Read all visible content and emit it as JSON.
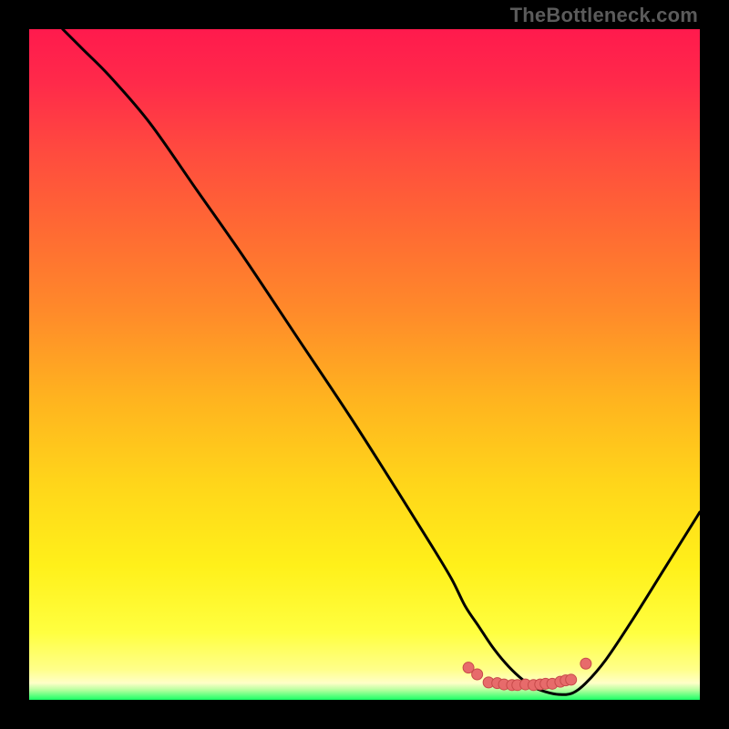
{
  "watermark": "TheBottleneck.com",
  "colors": {
    "background": "#000000",
    "gradient_stops": [
      {
        "offset": 0.0,
        "color": "#ff1a4d"
      },
      {
        "offset": 0.08,
        "color": "#ff2a4a"
      },
      {
        "offset": 0.18,
        "color": "#ff4a3f"
      },
      {
        "offset": 0.3,
        "color": "#ff6a33"
      },
      {
        "offset": 0.42,
        "color": "#ff8a2a"
      },
      {
        "offset": 0.55,
        "color": "#ffb31f"
      },
      {
        "offset": 0.68,
        "color": "#ffd61a"
      },
      {
        "offset": 0.8,
        "color": "#fff01a"
      },
      {
        "offset": 0.9,
        "color": "#ffff40"
      },
      {
        "offset": 0.955,
        "color": "#ffff8a"
      },
      {
        "offset": 0.975,
        "color": "#ffffc8"
      },
      {
        "offset": 0.985,
        "color": "#b8ffa0"
      },
      {
        "offset": 1.0,
        "color": "#1aff66"
      }
    ],
    "curve": "#000000",
    "marker_fill": "#e76b6b",
    "marker_stroke": "#c74a4a"
  },
  "chart_data": {
    "type": "line",
    "title": "",
    "xlabel": "",
    "ylabel": "",
    "xlim": [
      0,
      100
    ],
    "ylim": [
      0,
      100
    ],
    "series": [
      {
        "name": "bottleneck-curve",
        "x": [
          5,
          8,
          12,
          18,
          25,
          32,
          40,
          48,
          55,
          60,
          63,
          65,
          67,
          69,
          71,
          73,
          75,
          77,
          79,
          81,
          83,
          86,
          90,
          95,
          100
        ],
        "y": [
          100,
          97,
          93,
          86,
          76,
          66,
          54,
          42,
          31,
          23,
          18,
          14,
          11,
          8,
          5.5,
          3.5,
          2,
          1.2,
          0.8,
          1.0,
          2.5,
          6,
          12,
          20,
          28
        ]
      }
    ],
    "markers": {
      "name": "bottom-cluster",
      "points": [
        {
          "x": 65.5,
          "y": 4.8
        },
        {
          "x": 66.8,
          "y": 3.8
        },
        {
          "x": 68.5,
          "y": 2.6
        },
        {
          "x": 69.8,
          "y": 2.5
        },
        {
          "x": 70.8,
          "y": 2.3
        },
        {
          "x": 72.0,
          "y": 2.2
        },
        {
          "x": 72.8,
          "y": 2.2
        },
        {
          "x": 74.0,
          "y": 2.3
        },
        {
          "x": 75.2,
          "y": 2.2
        },
        {
          "x": 76.2,
          "y": 2.3
        },
        {
          "x": 77.0,
          "y": 2.4
        },
        {
          "x": 78.0,
          "y": 2.4
        },
        {
          "x": 79.2,
          "y": 2.7
        },
        {
          "x": 80.0,
          "y": 2.9
        },
        {
          "x": 80.8,
          "y": 3.0
        },
        {
          "x": 83.0,
          "y": 5.4
        }
      ]
    }
  }
}
